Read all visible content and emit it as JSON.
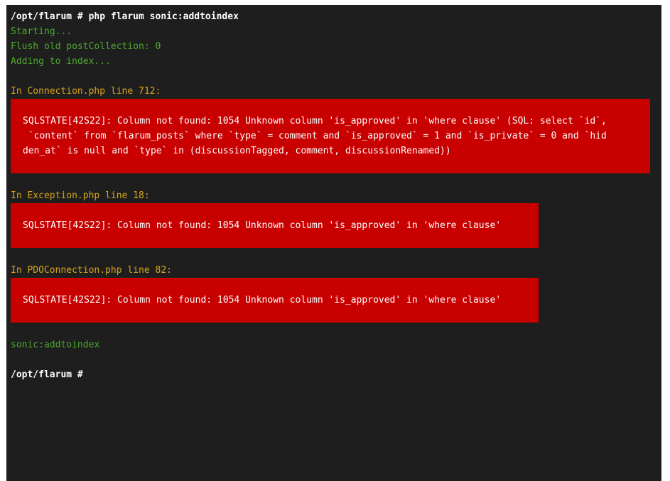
{
  "terminal": {
    "command_line": "/opt/flarum # php flarum sonic:addtoindex",
    "output": {
      "starting": "Starting...",
      "flush": "Flush old postCollection: 0",
      "adding": "Adding to index..."
    },
    "errors": [
      {
        "location": "In Connection.php line 712:",
        "message_lines": [
          "SQLSTATE[42S22]: Column not found: 1054 Unknown column 'is_approved' in 'where clause' (SQL: select `id`,",
          " `content` from `flarum_posts` where `type` = comment and `is_approved` = 1 and `is_private` = 0 and `hid",
          "den_at` is null and `type` in (discussionTagged, comment, discussionRenamed))"
        ]
      },
      {
        "location": "In Exception.php line 18:",
        "message_lines": [
          "SQLSTATE[42S22]: Column not found: 1054 Unknown column 'is_approved' in 'where clause'"
        ]
      },
      {
        "location": "In PDOConnection.php line 82:",
        "message_lines": [
          "SQLSTATE[42S22]: Column not found: 1054 Unknown column 'is_approved' in 'where clause'"
        ]
      }
    ],
    "usage": "sonic:addtoindex",
    "prompt": "/opt/flarum #"
  },
  "colors": {
    "background": "#1e1e1e",
    "success_text": "#4ea82f",
    "location_text": "#d7a51c",
    "error_bg": "#c80000"
  }
}
